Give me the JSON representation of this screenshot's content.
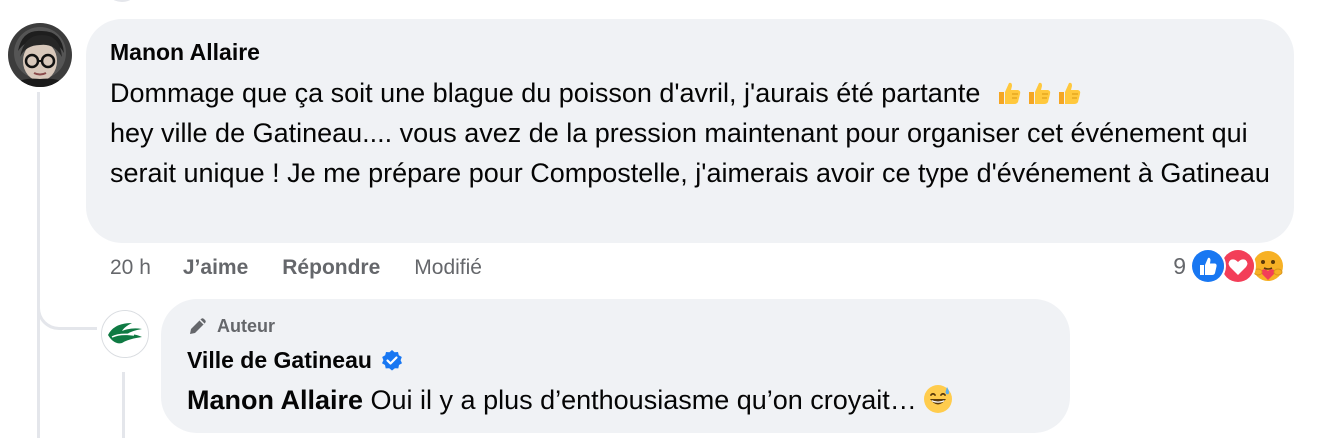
{
  "comment": {
    "author": "Manon Allaire",
    "text": "Dommage que ça soit une blague du poisson d'avril, j'aurais été partante",
    "text_continued": "hey ville de Gatineau.... vous avez de la pression maintenant pour organiser cet événement qui serait unique ! Je me prépare pour Compostelle, j'aimerais avoir ce type d'événement à Gatineau",
    "emoji_icon": "thumbs-up-icon",
    "time": "20 h",
    "like_label": "J’aime",
    "reply_label": "Répondre",
    "edited_label": "Modifié",
    "reaction_count": "9",
    "reactions": [
      "like-reaction-icon",
      "love-reaction-icon",
      "care-reaction-icon"
    ]
  },
  "reply": {
    "badge": "Auteur",
    "author": "Ville de Gatineau",
    "verified_icon": "verified-badge-icon",
    "mention": "Manon Allaire",
    "text": " Oui il y a plus d’enthousiasme qu’on croyait…",
    "emoji_icon": "grinning-sweat-icon"
  },
  "colors": {
    "bubble": "#f0f2f5",
    "meta_text": "#65676b",
    "like_blue": "#1877f2",
    "love_red": "#f33e58",
    "care_yellow": "#f7b125",
    "brand_green": "#0f7a43"
  }
}
